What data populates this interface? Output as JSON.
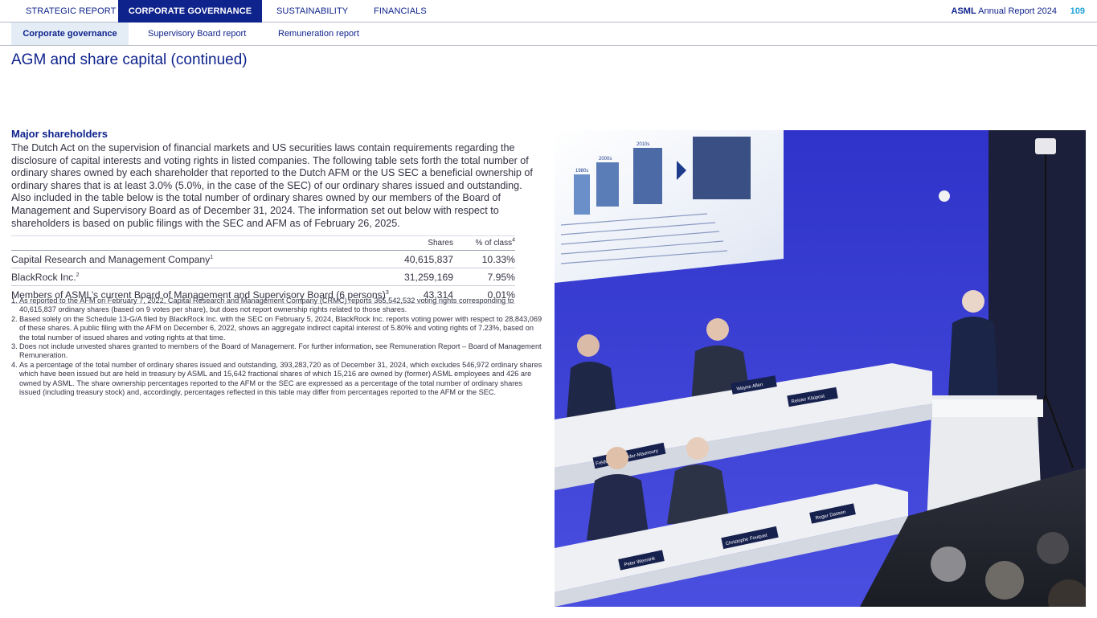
{
  "topnav": {
    "tabs": [
      {
        "label": "STRATEGIC REPORT",
        "active": false
      },
      {
        "label": "CORPORATE GOVERNANCE",
        "active": true
      },
      {
        "label": "SUSTAINABILITY",
        "active": false
      },
      {
        "label": "FINANCIALS",
        "active": false
      }
    ],
    "report_brand": "ASML",
    "report_title": "Annual Report 2024",
    "page_number": "109"
  },
  "subnav": {
    "tabs": [
      {
        "label": "Corporate governance",
        "active": true
      },
      {
        "label": "Supervisory Board report",
        "active": false
      },
      {
        "label": "Remuneration report",
        "active": false
      }
    ]
  },
  "page_title": "AGM and share capital (continued)",
  "section": {
    "heading": "Major shareholders",
    "body": "The Dutch Act on the supervision of financial markets and US securities laws contain requirements regarding the disclosure of capital interests and voting rights in listed companies. The following table sets forth the total number of ordinary shares owned by each shareholder that reported to the Dutch AFM or the US SEC a beneficial ownership of ordinary shares that is at least 3.0% (5.0%, in the case of the SEC) of our ordinary shares issued and outstanding. Also included in the table below is the total number of ordinary shares owned by our members of the Board of Management and Supervisory Board as of December 31, 2024. The information set out below with respect to shareholders is based on public filings with the SEC and AFM as of February 26, 2025."
  },
  "table": {
    "headers": {
      "shares": "Shares",
      "percent": "% of class",
      "percent_note": "4"
    },
    "rows": [
      {
        "name": "Capital Research and Management Company",
        "note": "1",
        "shares": "40,615,837",
        "percent": "10.33%"
      },
      {
        "name": "BlackRock Inc.",
        "note": "2",
        "shares": "31,259,169",
        "percent": "7.95%"
      },
      {
        "name": "Members of ASML’s current Board of Management and Supervisory Board (6 persons)",
        "note": "3",
        "shares": "43,314",
        "percent": "0.01%"
      }
    ]
  },
  "footnotes": [
    {
      "num": "1.",
      "text": "As reported to the AFM on February 7, 2022, Capital Research and Management Company (CRMC) reports 365,542,532 voting rights corresponding to 40,615,837 ordinary shares (based on 9 votes per share), but does not report ownership rights related to those shares."
    },
    {
      "num": "2.",
      "text": "Based solely on the Schedule 13-G/A filed by BlackRock Inc. with the SEC on February 5, 2024, BlackRock Inc. reports voting power with respect to 28,843,069 of these shares. A public filing with the AFM on December 6, 2022, shows an aggregate indirect capital interest of 5.80% and voting rights of 7.23%, based on the total number of issued shares and voting rights at that time."
    },
    {
      "num": "3.",
      "text": "Does not include unvested shares granted to members of the Board of Management. For further information, see Remuneration Report – Board of Management Remuneration."
    },
    {
      "num": "4.",
      "text": "As a percentage of the total number of ordinary shares issued and outstanding, 393,283,720 as of December 31, 2024, which excludes 546,972 ordinary shares which have been issued but are held in treasury by ASML and 15,642 fractional shares of which 15,216 are owned by (former) ASML employees and 426 are owned by ASML. The share ownership percentages reported to the AFM or the SEC are expressed as a percentage of the total number of ordinary shares issued (including treasury stock) and, accordingly, percentages reflected in this table may differ from percentages reported to the AFM or the SEC."
    }
  ],
  "photo": {
    "name_plates": [
      "Reinier Klaipost",
      "Wayne Allen",
      "Frédéric Schneider-Maunoury",
      "Roger Dassen",
      "Christophe Fouquet",
      "Peter Wennink"
    ],
    "screen_labels": [
      "1980s",
      "2000s",
      "2010s"
    ],
    "colors": {
      "stage_blue": "#3b3fd6",
      "desk_white": "#eef0f4",
      "plate_navy": "#17214e"
    }
  },
  "colors": {
    "brand_navy": "#0f238c",
    "page_number": "#1fa3d9",
    "subnav_active": "#e4edf6"
  }
}
